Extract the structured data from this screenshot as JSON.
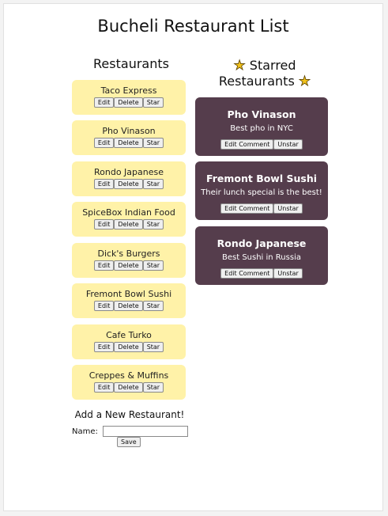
{
  "header": {
    "title": "Bucheli Restaurant List"
  },
  "restaurants": {
    "title": "Restaurants",
    "items": [
      {
        "name": "Taco Express"
      },
      {
        "name": "Pho Vinason"
      },
      {
        "name": "Rondo Japanese"
      },
      {
        "name": "SpiceBox Indian Food"
      },
      {
        "name": "Dick's Burgers"
      },
      {
        "name": "Fremont Bowl Sushi"
      },
      {
        "name": "Cafe Turko"
      },
      {
        "name": "Creppes & Muffins"
      }
    ],
    "edit_label": "Edit",
    "delete_label": "Delete",
    "star_label": "Star"
  },
  "starred": {
    "title_line1": "Starred",
    "title_line2": "Restaurants",
    "star_glyph": "★",
    "items": [
      {
        "name": "Pho Vinason",
        "comment": "Best pho in NYC"
      },
      {
        "name": "Fremont Bowl Sushi",
        "comment": "Their lunch special is the best!"
      },
      {
        "name": "Rondo Japanese",
        "comment": "Best Sushi in Russia"
      }
    ],
    "edit_comment_label": "Edit Comment",
    "unstar_label": "Unstar"
  },
  "add_form": {
    "title": "Add a New Restaurant!",
    "name_label": "Name:",
    "name_value": "",
    "save_label": "Save"
  },
  "colors": {
    "card_bg": "#fff2a8",
    "starred_bg": "#553d4c",
    "star": "#f2c21b"
  }
}
